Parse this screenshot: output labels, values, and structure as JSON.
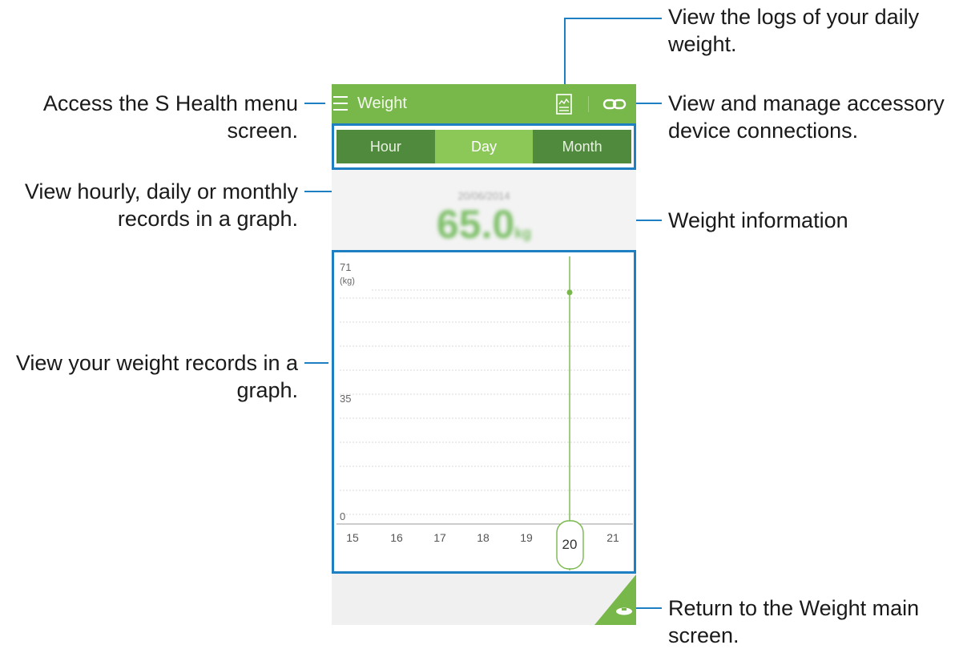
{
  "app": {
    "title": "Weight",
    "tabs": [
      {
        "label": "Hour",
        "active": false
      },
      {
        "label": "Day",
        "active": true
      },
      {
        "label": "Month",
        "active": false
      }
    ]
  },
  "weight_info": {
    "date": "20/06/2014",
    "value": "65.0",
    "unit": "kg"
  },
  "graph": {
    "y_max_label": "71",
    "y_unit_label": "(kg)",
    "y_mid_label": "35",
    "y_min_label": "0",
    "x_labels": [
      "15",
      "16",
      "17",
      "18",
      "19",
      "20",
      "21"
    ],
    "selected_day": "20"
  },
  "callouts": {
    "menu": "Access the S Health menu screen.",
    "menu_line1": "Access the S Health menu",
    "menu_line2": "screen.",
    "tabs_line1": "View hourly, daily or monthly",
    "tabs_line2": "records in a graph.",
    "graph_line1": "View your weight records in a",
    "graph_line2": "graph.",
    "logs_line1": "View the logs of your daily",
    "logs_line2": "weight.",
    "accessory_line1": "View and manage accessory",
    "accessory_line2": "device connections.",
    "info": "Weight information",
    "return_line1": "Return to the Weight main",
    "return_line2": "screen."
  },
  "colors": {
    "accent_green": "#78b84a",
    "tab_dark": "#4f8a3d",
    "tab_active": "#8bc858",
    "callout_blue": "#1e7fc3"
  }
}
